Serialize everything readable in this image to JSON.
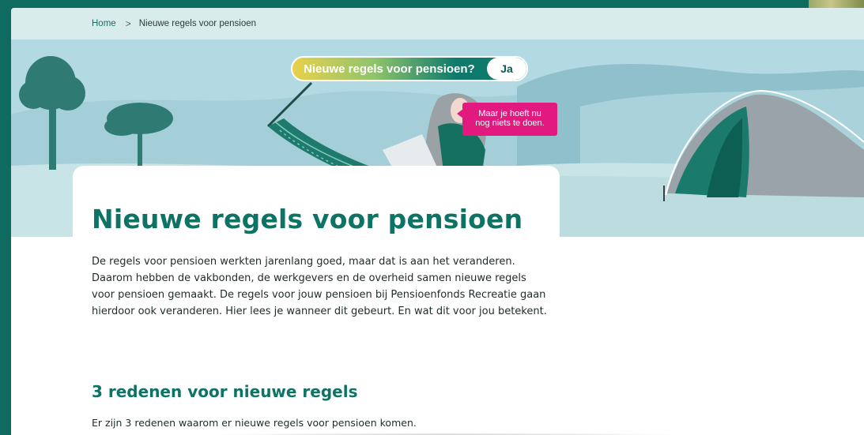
{
  "breadcrumb": {
    "home": "Home",
    "separator": ">",
    "current": "Nieuwe regels voor pensioen"
  },
  "hero": {
    "question": "Nieuwe regels voor pensioen?",
    "answer": "Ja",
    "bubble_line1": "Maar je hoeft nu",
    "bubble_line2": "nog niets te doen."
  },
  "main": {
    "title": "Nieuwe regels voor pensioen",
    "intro": "De regels voor pensioen werkten jarenlang goed, maar dat is aan het veranderen. Daarom hebben de vakbonden, de werkgevers en de overheid samen nieuwe regels voor pensioen gemaakt. De regels voor jouw pensioen bij Pensioenfonds Recreatie gaan hierdoor ook veranderen. Hier lees je wanneer dit gebeurt. En wat dit voor jou betekent.",
    "section_title": "3 redenen voor nieuwe regels",
    "section_text": "Er zijn 3 redenen waarom er nieuwe regels voor pensioen komen."
  },
  "colors": {
    "brand_green": "#0d7365",
    "breadcrumb_bg": "#d9ecec",
    "sky": "#b3d9e2",
    "bubble_pink": "#e2197e",
    "frame": "#0f6b60"
  }
}
